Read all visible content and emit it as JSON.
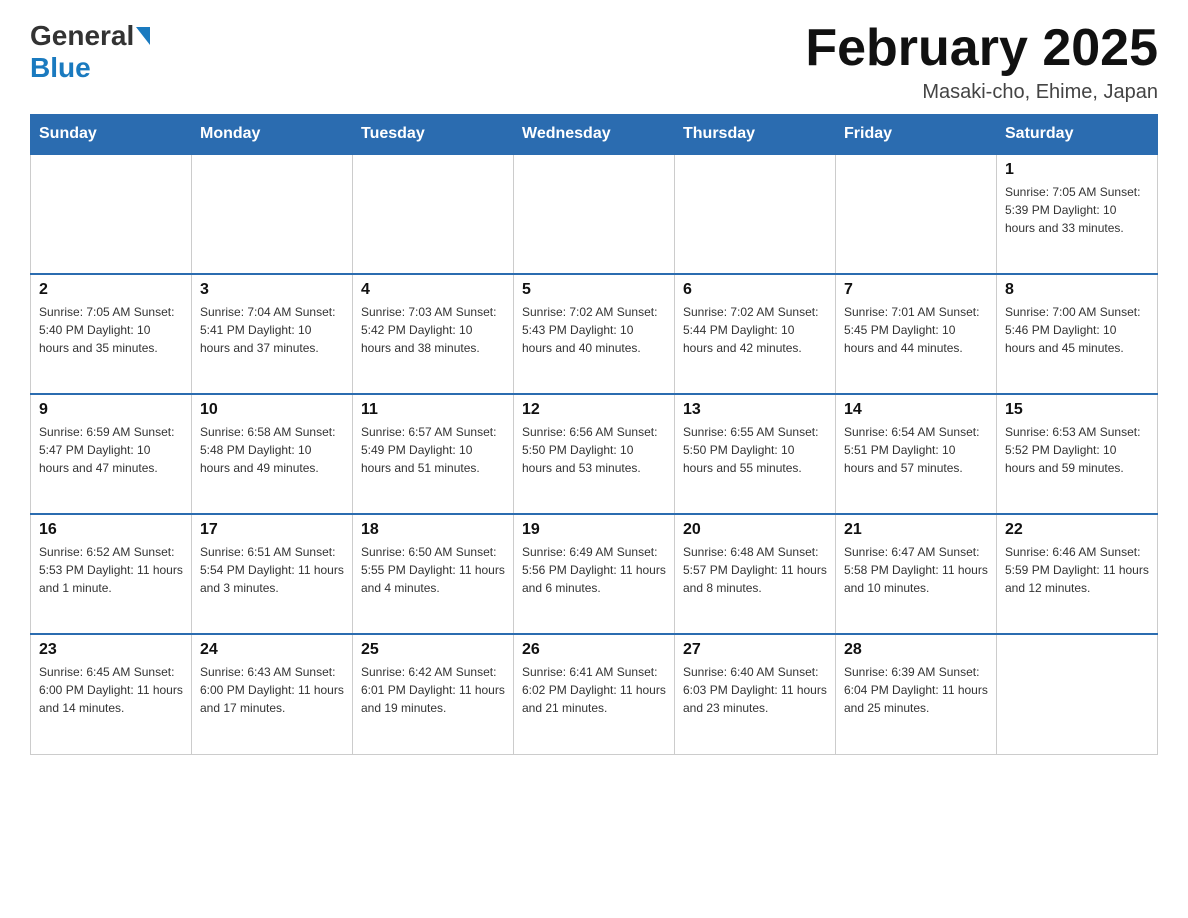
{
  "header": {
    "logo_general": "General",
    "logo_blue": "Blue",
    "month_title": "February 2025",
    "location": "Masaki-cho, Ehime, Japan"
  },
  "days_of_week": [
    "Sunday",
    "Monday",
    "Tuesday",
    "Wednesday",
    "Thursday",
    "Friday",
    "Saturday"
  ],
  "weeks": [
    [
      {
        "day": "",
        "info": ""
      },
      {
        "day": "",
        "info": ""
      },
      {
        "day": "",
        "info": ""
      },
      {
        "day": "",
        "info": ""
      },
      {
        "day": "",
        "info": ""
      },
      {
        "day": "",
        "info": ""
      },
      {
        "day": "1",
        "info": "Sunrise: 7:05 AM\nSunset: 5:39 PM\nDaylight: 10 hours and 33 minutes."
      }
    ],
    [
      {
        "day": "2",
        "info": "Sunrise: 7:05 AM\nSunset: 5:40 PM\nDaylight: 10 hours and 35 minutes."
      },
      {
        "day": "3",
        "info": "Sunrise: 7:04 AM\nSunset: 5:41 PM\nDaylight: 10 hours and 37 minutes."
      },
      {
        "day": "4",
        "info": "Sunrise: 7:03 AM\nSunset: 5:42 PM\nDaylight: 10 hours and 38 minutes."
      },
      {
        "day": "5",
        "info": "Sunrise: 7:02 AM\nSunset: 5:43 PM\nDaylight: 10 hours and 40 minutes."
      },
      {
        "day": "6",
        "info": "Sunrise: 7:02 AM\nSunset: 5:44 PM\nDaylight: 10 hours and 42 minutes."
      },
      {
        "day": "7",
        "info": "Sunrise: 7:01 AM\nSunset: 5:45 PM\nDaylight: 10 hours and 44 minutes."
      },
      {
        "day": "8",
        "info": "Sunrise: 7:00 AM\nSunset: 5:46 PM\nDaylight: 10 hours and 45 minutes."
      }
    ],
    [
      {
        "day": "9",
        "info": "Sunrise: 6:59 AM\nSunset: 5:47 PM\nDaylight: 10 hours and 47 minutes."
      },
      {
        "day": "10",
        "info": "Sunrise: 6:58 AM\nSunset: 5:48 PM\nDaylight: 10 hours and 49 minutes."
      },
      {
        "day": "11",
        "info": "Sunrise: 6:57 AM\nSunset: 5:49 PM\nDaylight: 10 hours and 51 minutes."
      },
      {
        "day": "12",
        "info": "Sunrise: 6:56 AM\nSunset: 5:50 PM\nDaylight: 10 hours and 53 minutes."
      },
      {
        "day": "13",
        "info": "Sunrise: 6:55 AM\nSunset: 5:50 PM\nDaylight: 10 hours and 55 minutes."
      },
      {
        "day": "14",
        "info": "Sunrise: 6:54 AM\nSunset: 5:51 PM\nDaylight: 10 hours and 57 minutes."
      },
      {
        "day": "15",
        "info": "Sunrise: 6:53 AM\nSunset: 5:52 PM\nDaylight: 10 hours and 59 minutes."
      }
    ],
    [
      {
        "day": "16",
        "info": "Sunrise: 6:52 AM\nSunset: 5:53 PM\nDaylight: 11 hours and 1 minute."
      },
      {
        "day": "17",
        "info": "Sunrise: 6:51 AM\nSunset: 5:54 PM\nDaylight: 11 hours and 3 minutes."
      },
      {
        "day": "18",
        "info": "Sunrise: 6:50 AM\nSunset: 5:55 PM\nDaylight: 11 hours and 4 minutes."
      },
      {
        "day": "19",
        "info": "Sunrise: 6:49 AM\nSunset: 5:56 PM\nDaylight: 11 hours and 6 minutes."
      },
      {
        "day": "20",
        "info": "Sunrise: 6:48 AM\nSunset: 5:57 PM\nDaylight: 11 hours and 8 minutes."
      },
      {
        "day": "21",
        "info": "Sunrise: 6:47 AM\nSunset: 5:58 PM\nDaylight: 11 hours and 10 minutes."
      },
      {
        "day": "22",
        "info": "Sunrise: 6:46 AM\nSunset: 5:59 PM\nDaylight: 11 hours and 12 minutes."
      }
    ],
    [
      {
        "day": "23",
        "info": "Sunrise: 6:45 AM\nSunset: 6:00 PM\nDaylight: 11 hours and 14 minutes."
      },
      {
        "day": "24",
        "info": "Sunrise: 6:43 AM\nSunset: 6:00 PM\nDaylight: 11 hours and 17 minutes."
      },
      {
        "day": "25",
        "info": "Sunrise: 6:42 AM\nSunset: 6:01 PM\nDaylight: 11 hours and 19 minutes."
      },
      {
        "day": "26",
        "info": "Sunrise: 6:41 AM\nSunset: 6:02 PM\nDaylight: 11 hours and 21 minutes."
      },
      {
        "day": "27",
        "info": "Sunrise: 6:40 AM\nSunset: 6:03 PM\nDaylight: 11 hours and 23 minutes."
      },
      {
        "day": "28",
        "info": "Sunrise: 6:39 AM\nSunset: 6:04 PM\nDaylight: 11 hours and 25 minutes."
      },
      {
        "day": "",
        "info": ""
      }
    ]
  ]
}
